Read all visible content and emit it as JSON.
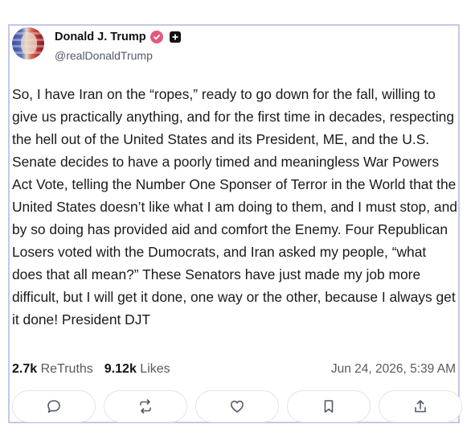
{
  "author": {
    "display_name": "Donald J. Trump",
    "handle": "@realDonaldTrump",
    "verified_badge_color": "#e05a7d"
  },
  "post": {
    "text": "So, I have Iran on the “ropes,” ready to go down for the fall, willing to give us practically anything, and for the first time in decades, respecting the hell out of the United States and its President, ME, and the U.S. Senate decides to have a poorly timed and meaningless War Powers Act Vote, telling the Number One Sponser of Terror in the World that the United States doesn’t like what I am doing to them, and I must stop, and by so doing has provided aid and comfort the Enemy. Four Republican Losers voted with the Dumocrats, and Iran asked my people, “what does that all mean?” These Senators have just made my job more difficult, but I will get it done, one way or the other, because I always get it done! President DJT",
    "retruths_count": "2.7k",
    "retruths_label": "ReTruths",
    "likes_count": "9.12k",
    "likes_label": "Likes",
    "timestamp": "Jun 24, 2026, 5:39 AM"
  },
  "actions": [
    {
      "icon": "reply-icon"
    },
    {
      "icon": "retruth-icon"
    },
    {
      "icon": "like-icon"
    },
    {
      "icon": "bookmark-icon"
    },
    {
      "icon": "share-icon"
    }
  ],
  "colors": {
    "card_border": "#c4c8ea",
    "text_secondary": "#555a66"
  }
}
